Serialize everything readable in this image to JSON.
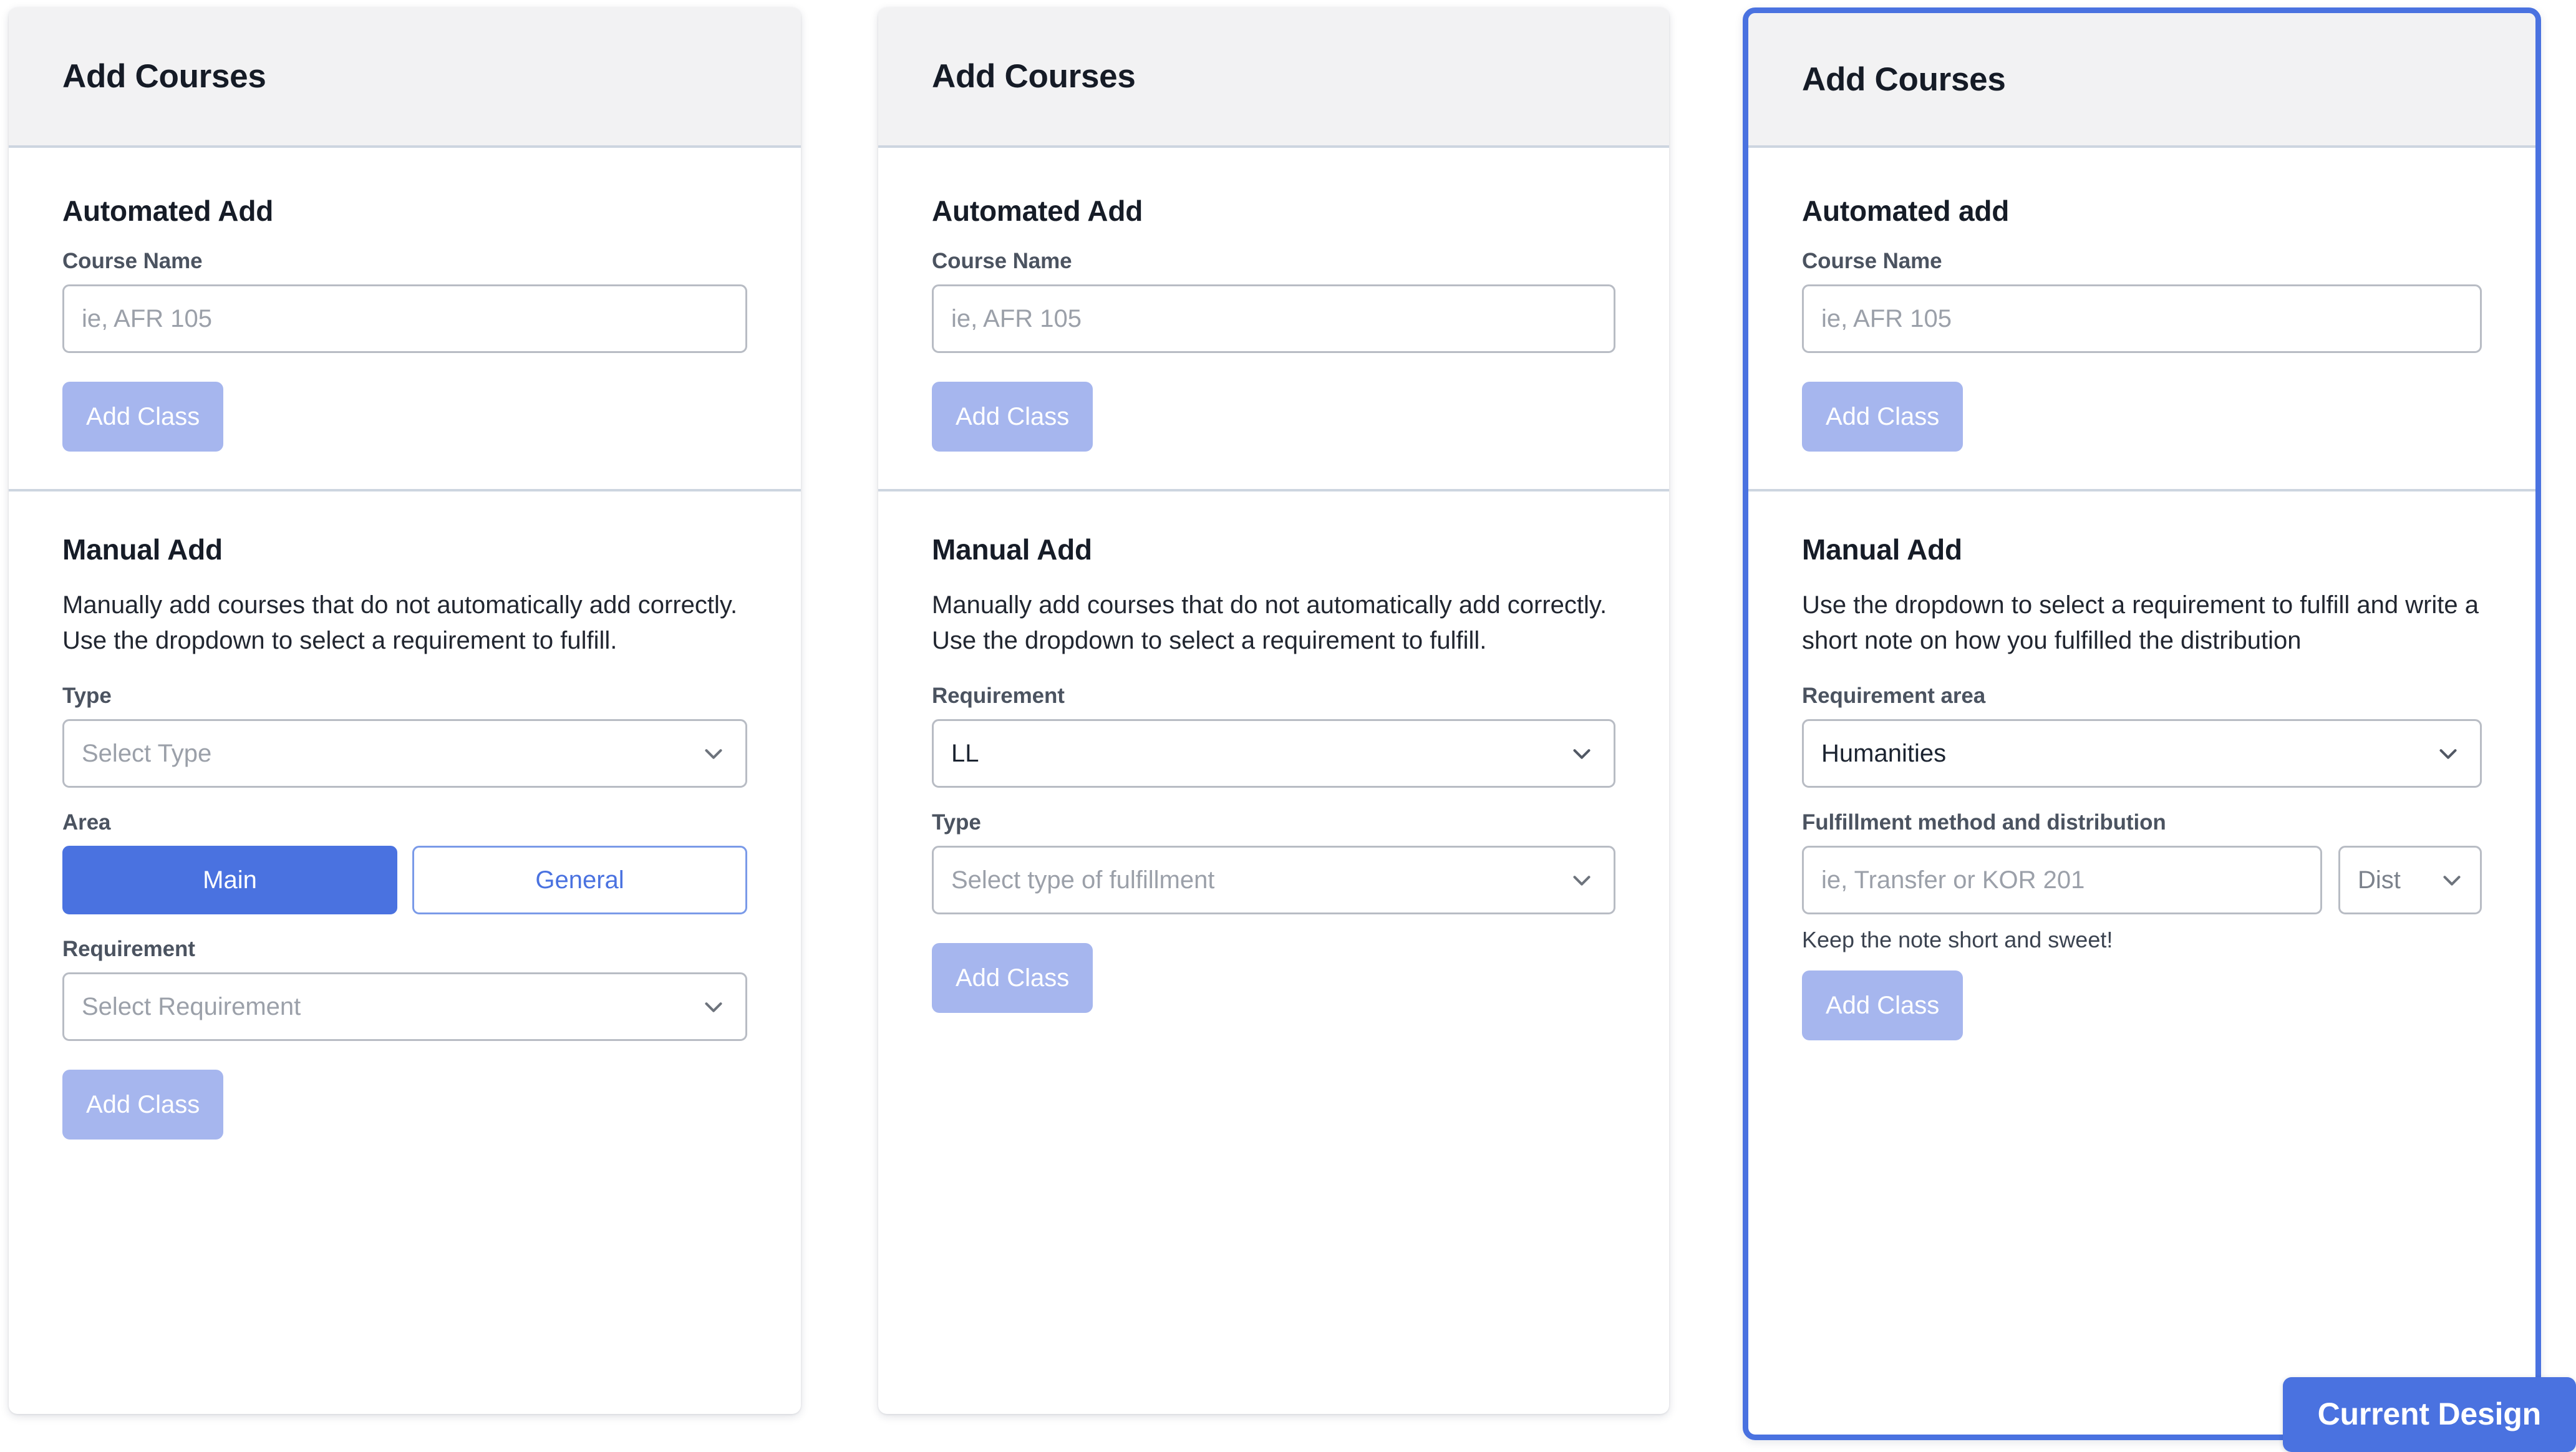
{
  "colors": {
    "accent_blue": "#4a72e0",
    "muted_button_blue": "#a6b6ee",
    "header_bg": "#f2f2f3",
    "divider": "#cdd5e0",
    "input_border": "#b8bcc4",
    "placeholder_text": "#9ba0a9"
  },
  "badge": {
    "label": "Current Design"
  },
  "cards": [
    {
      "header": "Add Courses",
      "automated": {
        "title": "Automated Add",
        "course_name_label": "Course Name",
        "course_name_placeholder": "ie, AFR 105",
        "add_class_label": "Add Class"
      },
      "manual": {
        "title": "Manual Add",
        "description": "Manually add courses that do not automatically add correctly. Use the dropdown to select a requirement to fulfill.",
        "type_label": "Type",
        "type_value": "Select Type",
        "area_label": "Area",
        "area_options": [
          "Main",
          "General"
        ],
        "area_selected": "Main",
        "requirement_label": "Requirement",
        "requirement_value": "Select Requirement",
        "add_class_label": "Add Class"
      }
    },
    {
      "header": "Add Courses",
      "automated": {
        "title": "Automated Add",
        "course_name_label": "Course Name",
        "course_name_placeholder": "ie, AFR 105",
        "add_class_label": "Add Class"
      },
      "manual": {
        "title": "Manual Add",
        "description": "Manually add courses that do not automatically add correctly. Use the dropdown to select a requirement to fulfill.",
        "requirement_label": "Requirement",
        "requirement_value": "LL",
        "type_label": "Type",
        "type_value": "Select type of fulfillment",
        "add_class_label": "Add Class"
      }
    },
    {
      "header": "Add Courses",
      "automated": {
        "title": "Automated add",
        "course_name_label": "Course Name",
        "course_name_placeholder": "ie, AFR 105",
        "add_class_label": "Add Class"
      },
      "manual": {
        "title": "Manual Add",
        "description": "Use the dropdown to select a requirement to fulfill and write a short note on how you fulfilled the distribution",
        "requirement_area_label": "Requirement area",
        "requirement_area_value": "Humanities",
        "fulfillment_label": "Fulfillment method and distribution",
        "fulfillment_placeholder": "ie, Transfer or KOR 201",
        "dist_value": "Dist",
        "helper": "Keep the note short and sweet!",
        "add_class_label": "Add Class"
      }
    }
  ]
}
